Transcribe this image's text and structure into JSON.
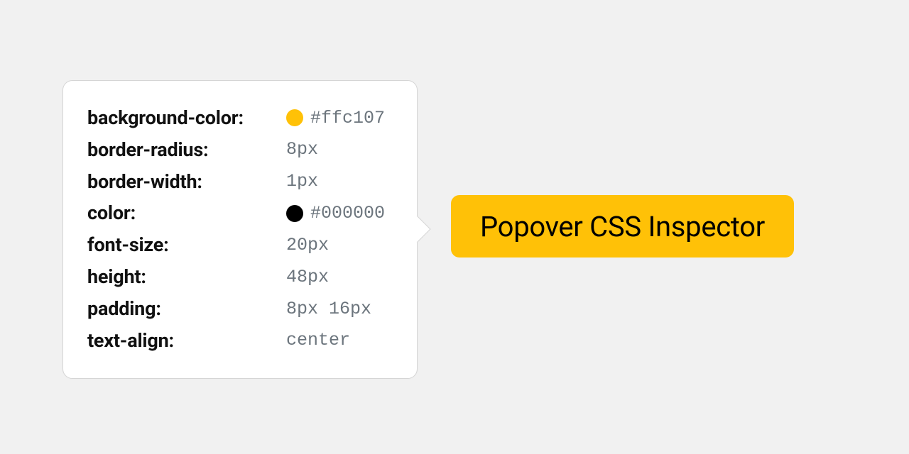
{
  "button": {
    "label": "Popover CSS Inspector"
  },
  "popover": {
    "properties": [
      {
        "name": "background-color:",
        "value": "#ffc107",
        "swatch": "#ffc107"
      },
      {
        "name": "border-radius:",
        "value": "8px"
      },
      {
        "name": "border-width:",
        "value": "1px"
      },
      {
        "name": "color:",
        "value": "#000000",
        "swatch": "#000000"
      },
      {
        "name": "font-size:",
        "value": "20px"
      },
      {
        "name": "height:",
        "value": "48px"
      },
      {
        "name": "padding:",
        "value": "8px 16px"
      },
      {
        "name": "text-align:",
        "value": "center"
      }
    ]
  }
}
